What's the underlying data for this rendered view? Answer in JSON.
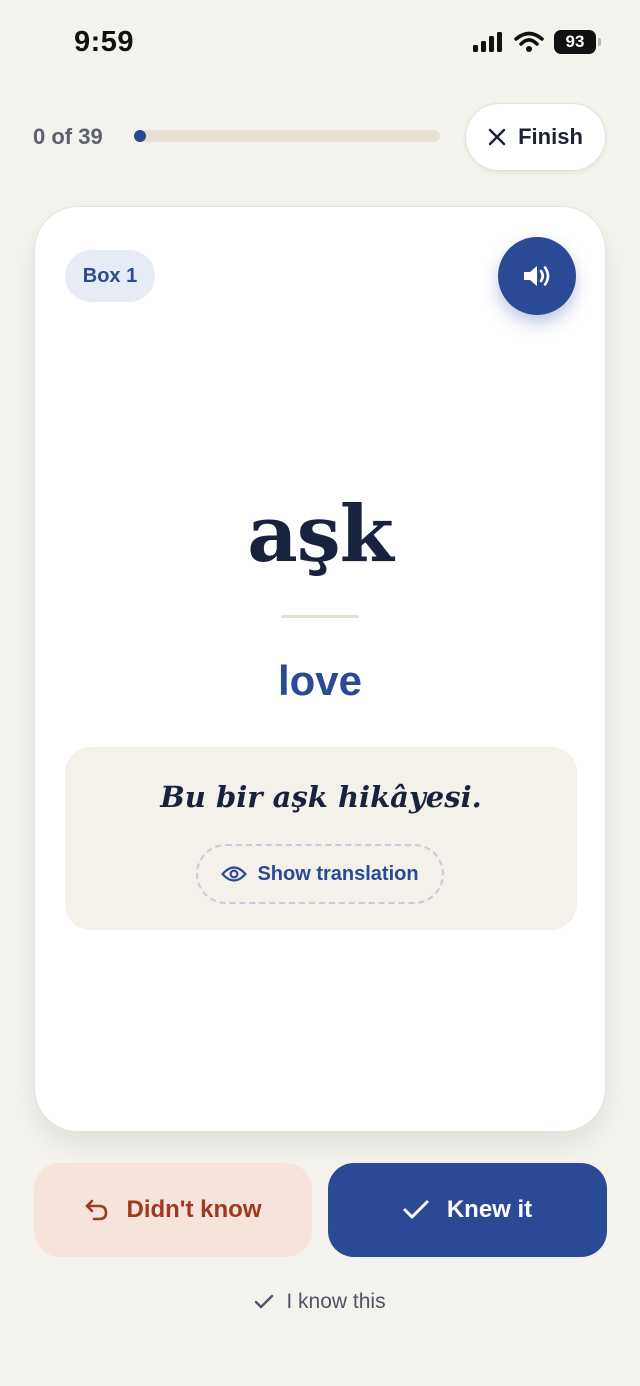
{
  "status_bar": {
    "time": "9:59",
    "battery": "93"
  },
  "progress": {
    "label": "0 of 39",
    "current": 0,
    "total": 39
  },
  "header": {
    "finish_label": "Finish"
  },
  "card": {
    "box_label": "Box 1",
    "word": "aşk",
    "translation": "love",
    "example_sentence": "Bu bir aşk hikâyesi.",
    "show_translation_label": "Show translation"
  },
  "actions": {
    "didnt_know_label": "Didn't know",
    "knew_it_label": "Knew it",
    "know_this_label": "I know this"
  },
  "colors": {
    "background": "#f3f2ec",
    "accent": "#2b4a95",
    "negative": "#9e3a1f",
    "negative_bg": "#f6e3dc"
  }
}
